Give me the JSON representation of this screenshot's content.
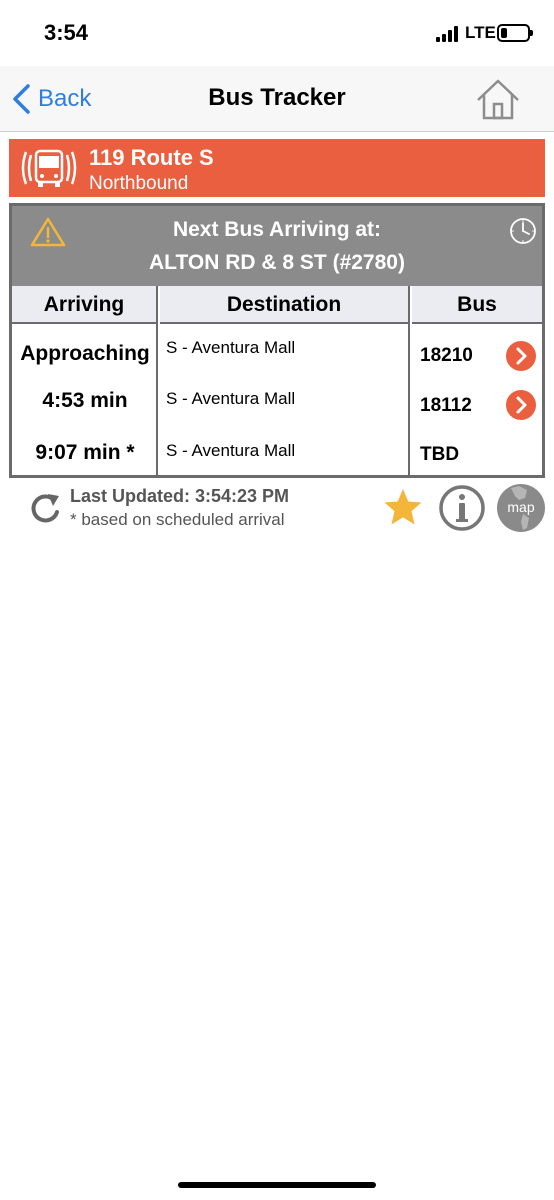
{
  "status_bar": {
    "time": "3:54",
    "network": "LTE"
  },
  "nav": {
    "back_label": "Back",
    "title": "Bus Tracker"
  },
  "route": {
    "title": "119 Route S",
    "direction": "Northbound",
    "color": "#e95f3f"
  },
  "panel": {
    "header_line1": "Next Bus Arriving at:",
    "header_line2": "ALTON RD & 8 ST (#2780)",
    "columns": [
      "Arriving",
      "Destination",
      "Bus"
    ],
    "rows": [
      {
        "arriving": "Approaching",
        "destination": "S - Aventura Mall",
        "bus": "18210",
        "has_link": true
      },
      {
        "arriving": "4:53 min",
        "destination": "S - Aventura Mall",
        "bus": "18112",
        "has_link": true
      },
      {
        "arriving": "9:07 min *",
        "destination": "S - Aventura Mall",
        "bus": "TBD",
        "has_link": false
      }
    ]
  },
  "footer": {
    "last_updated": "Last Updated: 3:54:23 PM",
    "note": "* based on scheduled arrival",
    "map_label": "map"
  },
  "icons": [
    "back-chevron-icon",
    "home-icon",
    "bus-icon",
    "warning-icon",
    "clock-icon",
    "refresh-icon",
    "star-icon",
    "info-icon",
    "map-icon"
  ]
}
